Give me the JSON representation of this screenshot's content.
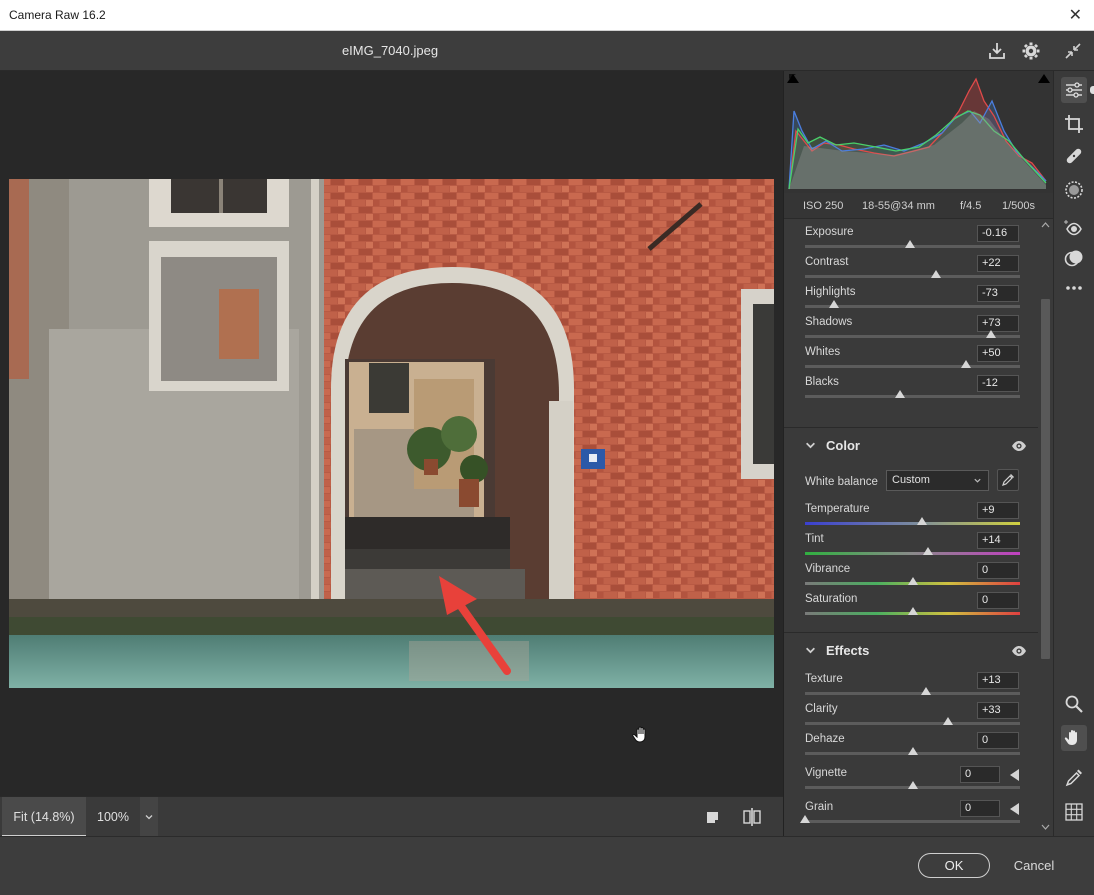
{
  "window": {
    "title": "Camera Raw 16.2"
  },
  "header": {
    "filename": "eIMG_7040.jpeg"
  },
  "exif": {
    "iso": "ISO 250",
    "lens": "18-55@34 mm",
    "aperture": "f/4.5",
    "shutter": "1/500s"
  },
  "light": [
    {
      "label": "Exposure",
      "value": "-0.16",
      "level": 0.49
    },
    {
      "label": "Contrast",
      "value": "+22",
      "level": 0.61
    },
    {
      "label": "Highlights",
      "value": "-73",
      "level": 0.135
    },
    {
      "label": "Shadows",
      "value": "+73",
      "level": 0.865
    },
    {
      "label": "Whites",
      "value": "+50",
      "level": 0.75
    },
    {
      "label": "Blacks",
      "value": "-12",
      "level": 0.44
    }
  ],
  "color": {
    "title": "Color",
    "white_balance_label": "White balance",
    "white_balance_value": "Custom",
    "sliders": [
      {
        "label": "Temperature",
        "value": "+9",
        "level": 0.545,
        "track": "temp"
      },
      {
        "label": "Tint",
        "value": "+14",
        "level": 0.57,
        "track": "tint"
      },
      {
        "label": "Vibrance",
        "value": "0",
        "level": 0.5,
        "track": "sat"
      },
      {
        "label": "Saturation",
        "value": "0",
        "level": 0.5,
        "track": "sat"
      }
    ]
  },
  "effects": {
    "title": "Effects",
    "sliders": [
      {
        "label": "Texture",
        "value": "+13",
        "level": 0.565
      },
      {
        "label": "Clarity",
        "value": "+33",
        "level": 0.665
      },
      {
        "label": "Dehaze",
        "value": "0",
        "level": 0.5
      },
      {
        "label": "Vignette",
        "value": "0",
        "level": 0.5,
        "short": true
      },
      {
        "label": "Grain",
        "value": "0",
        "level": 0.0,
        "short": true
      }
    ]
  },
  "bottom": {
    "zoom_fit": "Fit (14.8%)",
    "zoom_100": "100%"
  },
  "footer": {
    "ok": "OK",
    "cancel": "Cancel"
  },
  "colors": {
    "accent_red": "#e8413a",
    "panel_bg": "#3a3a3a",
    "canvas_bg": "#282828"
  }
}
